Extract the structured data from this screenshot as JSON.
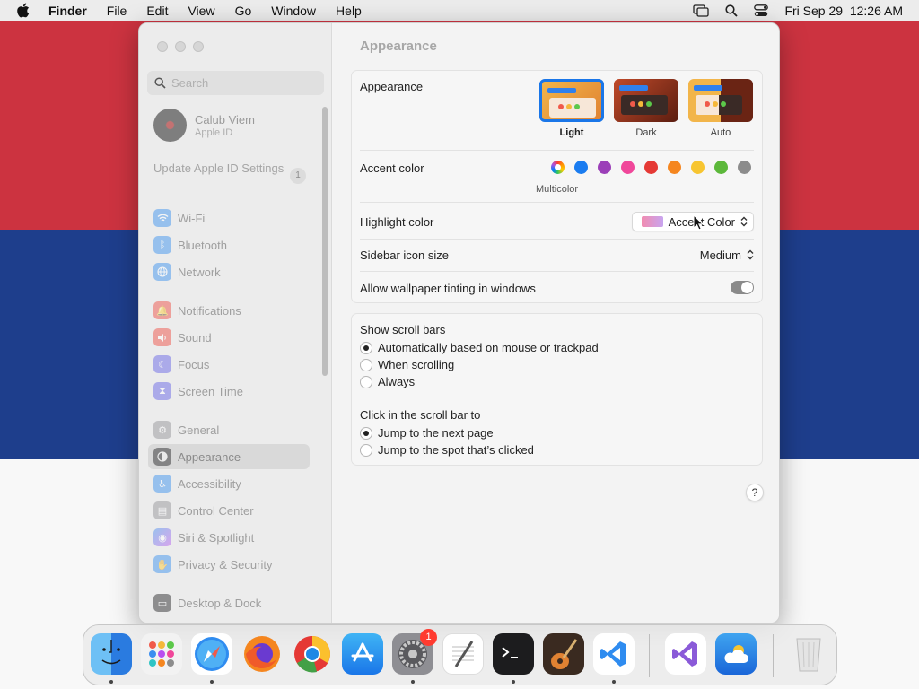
{
  "menubar": {
    "app": "Finder",
    "items": [
      "File",
      "Edit",
      "View",
      "Go",
      "Window",
      "Help"
    ],
    "clock": "Fri Sep 29  12:26 AM"
  },
  "sidebar": {
    "search_placeholder": "Search",
    "account": {
      "name": "Calub Viem",
      "sub": "Apple ID"
    },
    "update": {
      "label": "Update Apple ID Settings",
      "badge": "1"
    },
    "items": [
      {
        "label": "Wi-Fi",
        "icon": "wifi-icon",
        "color": "#2f8cf0"
      },
      {
        "label": "Bluetooth",
        "icon": "bluetooth-icon",
        "color": "#2f8cf0"
      },
      {
        "label": "Network",
        "icon": "globe-icon",
        "color": "#2f8cf0"
      },
      {
        "label": "Notifications",
        "icon": "bell-icon",
        "color": "#f0453a"
      },
      {
        "label": "Sound",
        "icon": "speaker-icon",
        "color": "#f0453a"
      },
      {
        "label": "Focus",
        "icon": "moon-icon",
        "color": "#5e5ce6"
      },
      {
        "label": "Screen Time",
        "icon": "hourglass-icon",
        "color": "#5e5ce6"
      },
      {
        "label": "General",
        "icon": "gear-icon",
        "color": "#8e8e93"
      },
      {
        "label": "Appearance",
        "icon": "appearance-icon",
        "color": "#1c1c1e"
      },
      {
        "label": "Accessibility",
        "icon": "accessibility-icon",
        "color": "#2f8cf0"
      },
      {
        "label": "Control Center",
        "icon": "control-center-icon",
        "color": "#8e8e93"
      },
      {
        "label": "Siri & Spotlight",
        "icon": "siri-icon",
        "color": "#b84ff0"
      },
      {
        "label": "Privacy & Security",
        "icon": "hand-icon",
        "color": "#2f8cf0"
      },
      {
        "label": "Desktop & Dock",
        "icon": "dock-icon",
        "color": "#1c1c1e"
      }
    ],
    "selected": "Appearance"
  },
  "main": {
    "title": "Appearance",
    "appearance": {
      "label": "Appearance",
      "options": [
        "Light",
        "Dark",
        "Auto"
      ],
      "selected": "Light"
    },
    "accent": {
      "label": "Accent color",
      "colors": [
        "multicolor",
        "#1a7cf0",
        "#9b3fb8",
        "#f0479a",
        "#e53935",
        "#f5861f",
        "#f7c531",
        "#5cb83a",
        "#8c8c8c"
      ],
      "selected_label": "Multicolor"
    },
    "highlight": {
      "label": "Highlight color",
      "value": "Accent Color"
    },
    "sidebar_icon_size": {
      "label": "Sidebar icon size",
      "value": "Medium"
    },
    "wallpaper_tinting": {
      "label": "Allow wallpaper tinting in windows",
      "on": false
    },
    "scroll_bars": {
      "label": "Show scroll bars",
      "options": [
        "Automatically based on mouse or trackpad",
        "When scrolling",
        "Always"
      ],
      "selected": 0
    },
    "click_scroll": {
      "label": "Click in the scroll bar to",
      "options": [
        "Jump to the next page",
        "Jump to the spot that’s clicked"
      ],
      "selected": 0
    },
    "help": "?"
  },
  "dock": {
    "apps": [
      "Finder",
      "Launchpad",
      "Safari",
      "Firefox",
      "Chrome",
      "App Store",
      "System Settings",
      "TextEdit",
      "Terminal",
      "GarageBand",
      "Visual Studio Code",
      "Visual Studio",
      "Weather",
      "Trash"
    ],
    "badge": "1"
  }
}
